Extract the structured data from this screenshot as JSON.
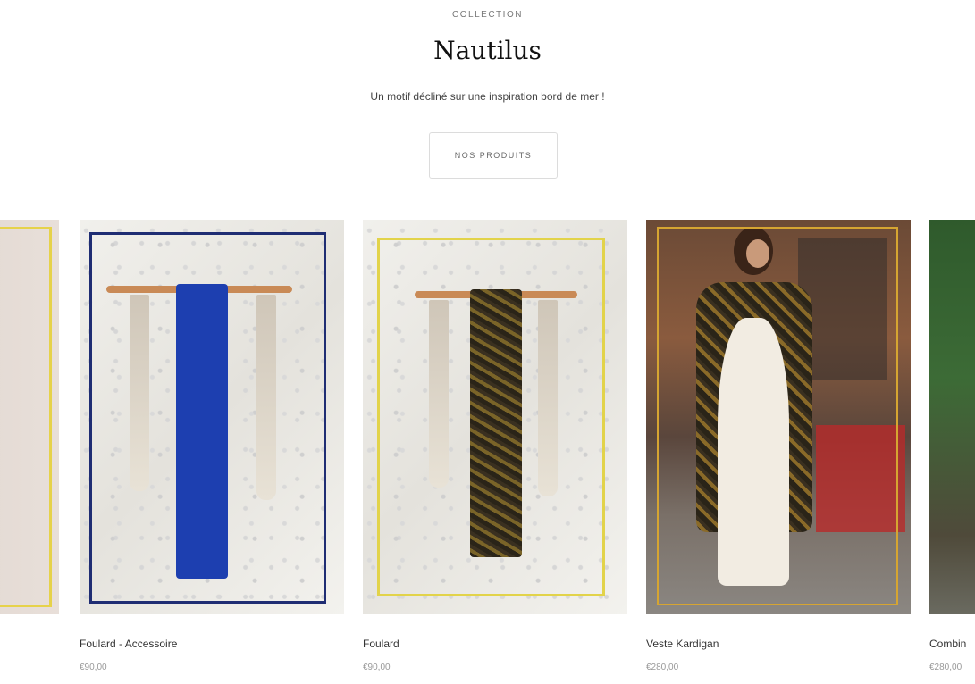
{
  "header": {
    "eyebrow": "COLLECTION",
    "title": "Nautilus",
    "subtitle": "Un motif décliné sur une inspiration bord de mer !",
    "cta_label": "NOS PRODUITS"
  },
  "products": [
    {
      "name": "Foulard - Accessoire",
      "price": "€90,00",
      "frame_color": "#1f2d73",
      "scarf_color": "#1d3fb0"
    },
    {
      "name": "Foulard",
      "price": "€90,00",
      "frame_color": "#e2d34a",
      "scarf_color": "#3a3018"
    },
    {
      "name": "Veste Kardigan",
      "price": "€280,00",
      "frame_color": "#d6a531"
    },
    {
      "name": "Combin",
      "price": "€280,00"
    }
  ]
}
